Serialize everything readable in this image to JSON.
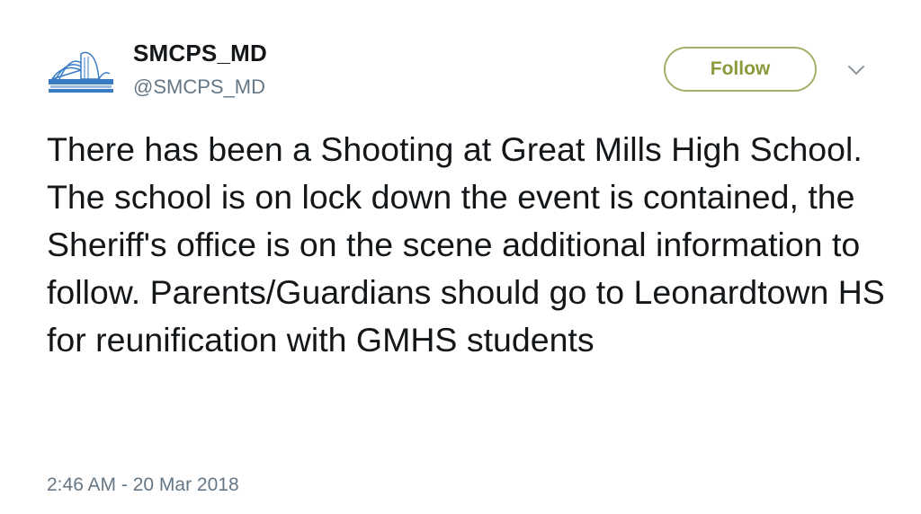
{
  "account": {
    "display_name": "SMCPS_MD",
    "handle": "@SMCPS_MD",
    "avatar_icon": "open-book-logo-icon"
  },
  "actions": {
    "follow_label": "Follow",
    "menu_icon": "chevron-down-icon"
  },
  "tweet": {
    "text": "There has been a Shooting at Great Mills High School.  The school is on lock down the event is contained, the Sheriff's office is on the scene additional information to follow. Parents/Guardians should go to Leonardtown HS for reunification with GMHS students",
    "timestamp": "2:46 AM - 20 Mar 2018"
  },
  "colors": {
    "follow_accent": "#a4b06a",
    "secondary_text": "#657786",
    "logo_blue": "#3a7cc4"
  }
}
